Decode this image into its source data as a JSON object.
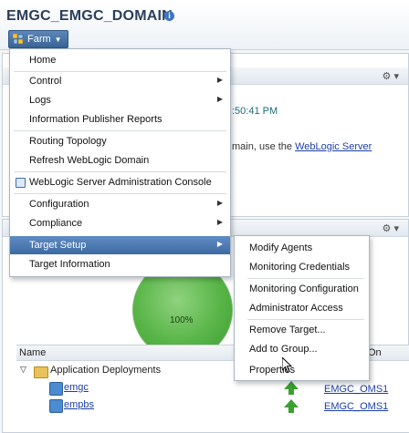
{
  "header": {
    "title": "EMGC_EMGC_DOMAIN",
    "info_icon": "info-icon",
    "farm_menu_label": "Farm"
  },
  "background": {
    "time_fragment": ":50:41 PM",
    "domain_text": "main, use the ",
    "domain_link": "WebLogic Server",
    "donut_value": "100%",
    "table": {
      "columns": [
        "Name",
        "On"
      ],
      "rows": [
        {
          "name": "Application Deployments",
          "type": "folder",
          "expanded": true
        },
        {
          "name": "emgc",
          "type": "app",
          "status": "up",
          "target": "EMGC_OMS1"
        },
        {
          "name": "empbs",
          "type": "app",
          "status": "up",
          "target": "EMGC_OMS1"
        }
      ]
    }
  },
  "menu": {
    "items": [
      {
        "label": "Home",
        "submenu": false
      },
      {
        "label": "Control",
        "submenu": true
      },
      {
        "label": "Logs",
        "submenu": true
      },
      {
        "label": "Information Publisher Reports",
        "submenu": false
      },
      {
        "label": "Routing Topology",
        "submenu": false
      },
      {
        "label": "Refresh WebLogic Domain",
        "submenu": false
      },
      {
        "label": "WebLogic Server Administration Console",
        "submenu": false,
        "icon": "weblogic-console-icon"
      },
      {
        "label": "Configuration",
        "submenu": true
      },
      {
        "label": "Compliance",
        "submenu": true
      },
      {
        "label": "Target Setup",
        "submenu": true,
        "selected": true
      },
      {
        "label": "Target Information",
        "submenu": false
      }
    ]
  },
  "submenu": {
    "items": [
      {
        "label": "Modify Agents"
      },
      {
        "label": "Monitoring Credentials"
      },
      {
        "label": "Monitoring Configuration"
      },
      {
        "label": "Administrator Access"
      },
      {
        "label": "Remove Target..."
      },
      {
        "label": "Add to Group..."
      },
      {
        "label": "Properties"
      }
    ]
  },
  "colors": {
    "menu_selected": "#4a77ae",
    "status_up": "#3aa02f",
    "link": "#1c3fa8"
  }
}
